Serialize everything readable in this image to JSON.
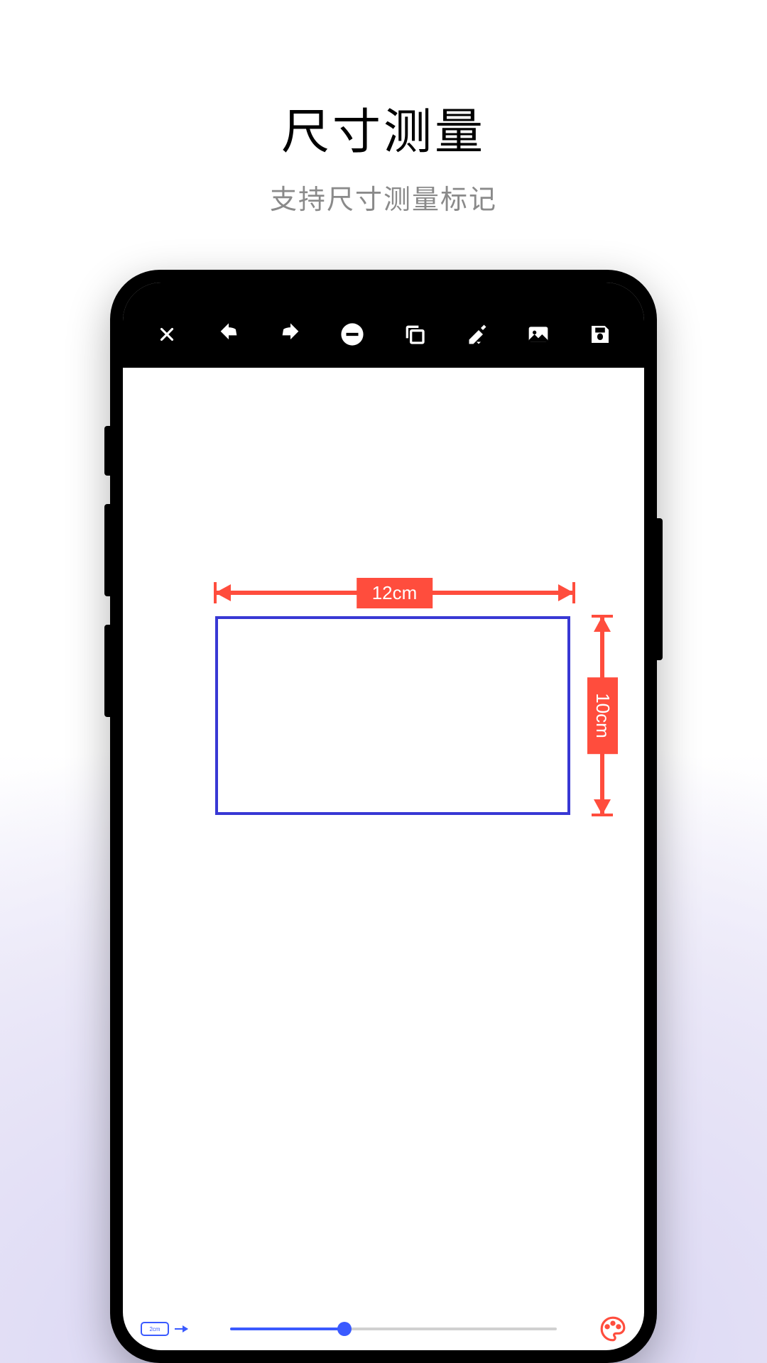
{
  "header": {
    "title": "尺寸测量",
    "subtitle": "支持尺寸测量标记"
  },
  "canvas": {
    "width_label": "12cm",
    "height_label": "10cm"
  },
  "bottom": {
    "chip_label": "2cm"
  },
  "colors": {
    "accent_red": "#ff4d3d",
    "rect_blue": "#3838d4",
    "slider_blue": "#3a5aff"
  }
}
